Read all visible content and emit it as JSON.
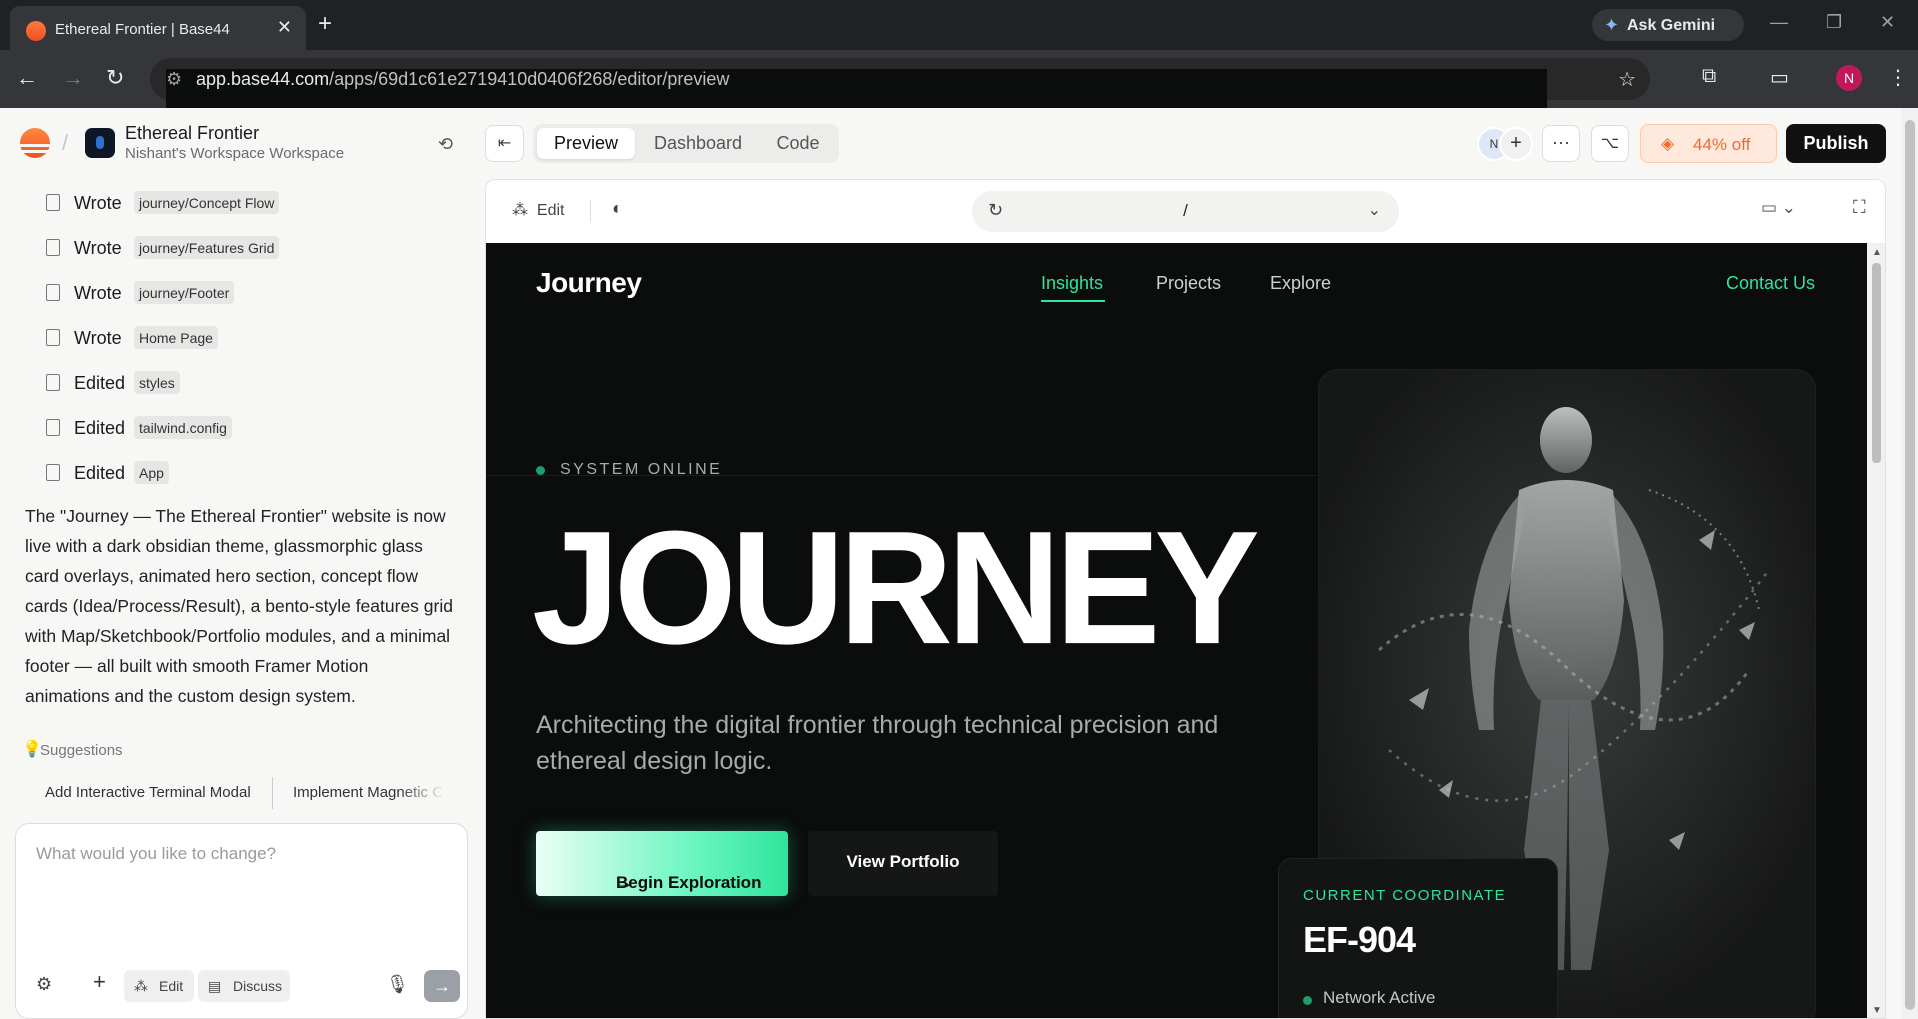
{
  "browser": {
    "tab_title": "Ethereal Frontier | Base44",
    "url_host": "app.base44.com",
    "url_path": "/apps/69d1c61e2719410d0406f268/editor/preview",
    "ask_gemini": "Ask Gemini",
    "profile_initial": "N"
  },
  "project": {
    "name": "Ethereal Frontier",
    "workspace": "Nishant's Workspace Workspace"
  },
  "activity": [
    {
      "verb": "Wrote",
      "file": "journey/Concept Flow"
    },
    {
      "verb": "Wrote",
      "file": "journey/Features Grid"
    },
    {
      "verb": "Wrote",
      "file": "journey/Footer"
    },
    {
      "verb": "Wrote",
      "file": "Home Page"
    },
    {
      "verb": "Edited",
      "file": "styles"
    },
    {
      "verb": "Edited",
      "file": "tailwind.config"
    },
    {
      "verb": "Edited",
      "file": "App"
    }
  ],
  "summary": "The \"Journey — The Ethereal Frontier\" website is now live with a dark obsidian theme, glassmorphic glass card overlays, animated hero section, concept flow cards (Idea/Process/Result), a bento-style features grid with Map/Sketchbook/Portfolio modules, and a minimal footer — all built with smooth Framer Motion animations and the custom design system.",
  "suggestions": {
    "label": "Suggestions",
    "items": [
      "Add Interactive Terminal Modal",
      "Implement Magnetic Cursor"
    ]
  },
  "chat": {
    "placeholder": "What would you like to change?",
    "edit_label": "Edit",
    "discuss_label": "Discuss"
  },
  "editor": {
    "tabs": [
      "Preview",
      "Dashboard",
      "Code"
    ],
    "active_tab": "Preview",
    "avatar_initial": "N",
    "discount": "44% off",
    "publish": "Publish",
    "edit_label": "Edit",
    "route": "/"
  },
  "site": {
    "brand": "Journey",
    "nav": [
      "Insights",
      "Projects",
      "Explore"
    ],
    "active_nav": "Insights",
    "contact": "Contact Us",
    "status": "SYSTEM ONLINE",
    "hero": "JOURNEY",
    "subtitle": "Architecting the digital frontier through technical precision and ethereal design logic.",
    "cta_primary": "Begin Exploration",
    "cta_secondary": "View Portfolio",
    "coord_label": "CURRENT COORDINATE",
    "coord_value": "EF-904",
    "network": "Network Active",
    "accent": "#2ee59d"
  }
}
